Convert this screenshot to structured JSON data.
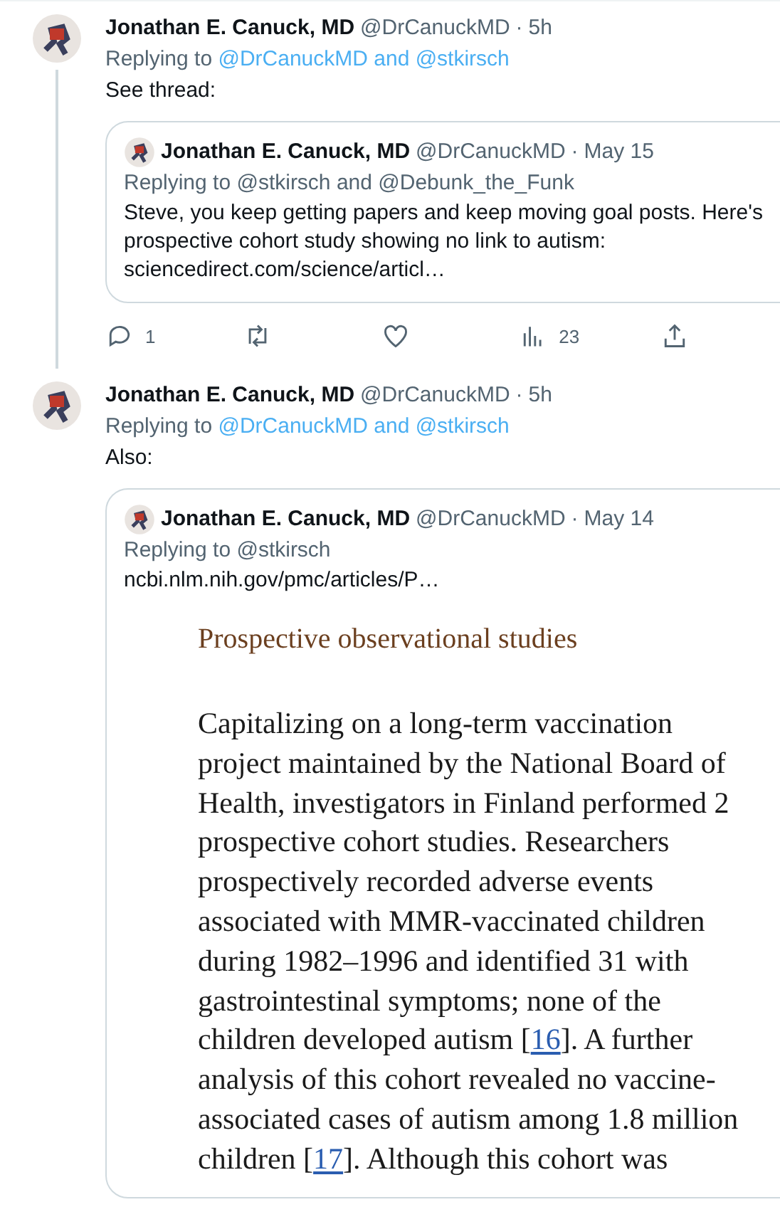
{
  "tweets": [
    {
      "name": "Jonathan E. Canuck, MD",
      "handle": "@DrCanuckMD",
      "separator": "·",
      "time": "5h",
      "replying_label": "Replying to",
      "replying_to": "@DrCanuckMD and @stkirsch",
      "text": "See thread:",
      "thread_line": true,
      "quote": {
        "name": "Jonathan E. Canuck, MD",
        "handle": "@DrCanuckMD",
        "separator": "·",
        "time": "May 15",
        "replying": "Replying to @stkirsch and @Debunk_the_Funk",
        "lines": [
          "Steve, you keep getting papers and keep moving goal posts. Here's",
          "prospective cohort study showing no link to autism:",
          "sciencedirect.com/science/articl…"
        ]
      },
      "actions": [
        {
          "kind": "reply",
          "count": "1"
        },
        {
          "kind": "retweet"
        },
        {
          "kind": "like"
        },
        {
          "kind": "views",
          "count": "23"
        },
        {
          "kind": "share"
        }
      ]
    },
    {
      "name": "Jonathan E. Canuck, MD",
      "handle": "@DrCanuckMD",
      "separator": "·",
      "time": "5h",
      "replying_label": "Replying to",
      "replying_to": "@DrCanuckMD and @stkirsch",
      "text": "Also:",
      "thread_line": false,
      "quote": {
        "name": "Jonathan E. Canuck, MD",
        "handle": "@DrCanuckMD",
        "separator": "·",
        "time": "May 14",
        "replying": "Replying to @stkirsch",
        "lines": [
          "ncbi.nlm.nih.gov/pmc/articles/P…"
        ],
        "document": {
          "heading": "Prospective observational studies",
          "paragraph": [
            [
              {
                "text": "Capitalizing on a long-term vaccination"
              }
            ],
            [
              {
                "text": "project maintained by the National Board of"
              }
            ],
            [
              {
                "text": "Health, investigators in Finland performed 2"
              }
            ],
            [
              {
                "text": "prospective cohort studies. Researchers"
              }
            ],
            [
              {
                "text": "prospectively recorded adverse events"
              }
            ],
            [
              {
                "text": "associated with MMR-vaccinated children"
              }
            ],
            [
              {
                "text": "during 1982–1996 and identified 31 with"
              }
            ],
            [
              {
                "text": "gastrointestinal symptoms; none of the"
              }
            ],
            [
              {
                "text": "children developed autism ["
              },
              {
                "text": "16",
                "kind": "link"
              },
              {
                "text": "]. A further"
              }
            ],
            [
              {
                "text": "analysis of this cohort revealed no vaccine-"
              }
            ],
            [
              {
                "text": "associated cases of autism among 1.8 million"
              }
            ],
            [
              {
                "text": "children ["
              },
              {
                "text": "17",
                "kind": "link"
              },
              {
                "text": "]. Although this cohort was"
              }
            ]
          ]
        }
      }
    }
  ]
}
